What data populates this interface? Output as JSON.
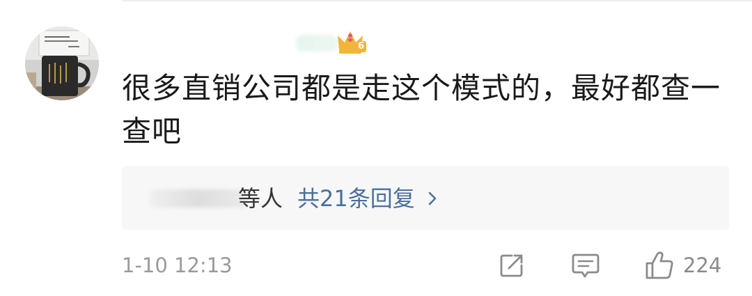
{
  "comment": {
    "text": "很多直销公司都是走这个模式的，最好都查一查吧",
    "vip_level": "6",
    "replies": {
      "suffix": "等人",
      "link_label": "共21条回复"
    },
    "timestamp": "1-10 12:13",
    "likes": "224"
  },
  "icons": {
    "share": "share-icon",
    "comment": "comment-icon",
    "like": "thumbs-up-icon",
    "chevron": "chevron-right-icon",
    "vip": "vip-crown-badge-icon"
  },
  "colors": {
    "text": "#1a1a1a",
    "link": "#4a6f9c",
    "muted": "#9a9a9a",
    "reply_box_bg": "#f7f7f7",
    "badge_gold": "#f2b53a",
    "badge_pink": "#e85a7a"
  }
}
